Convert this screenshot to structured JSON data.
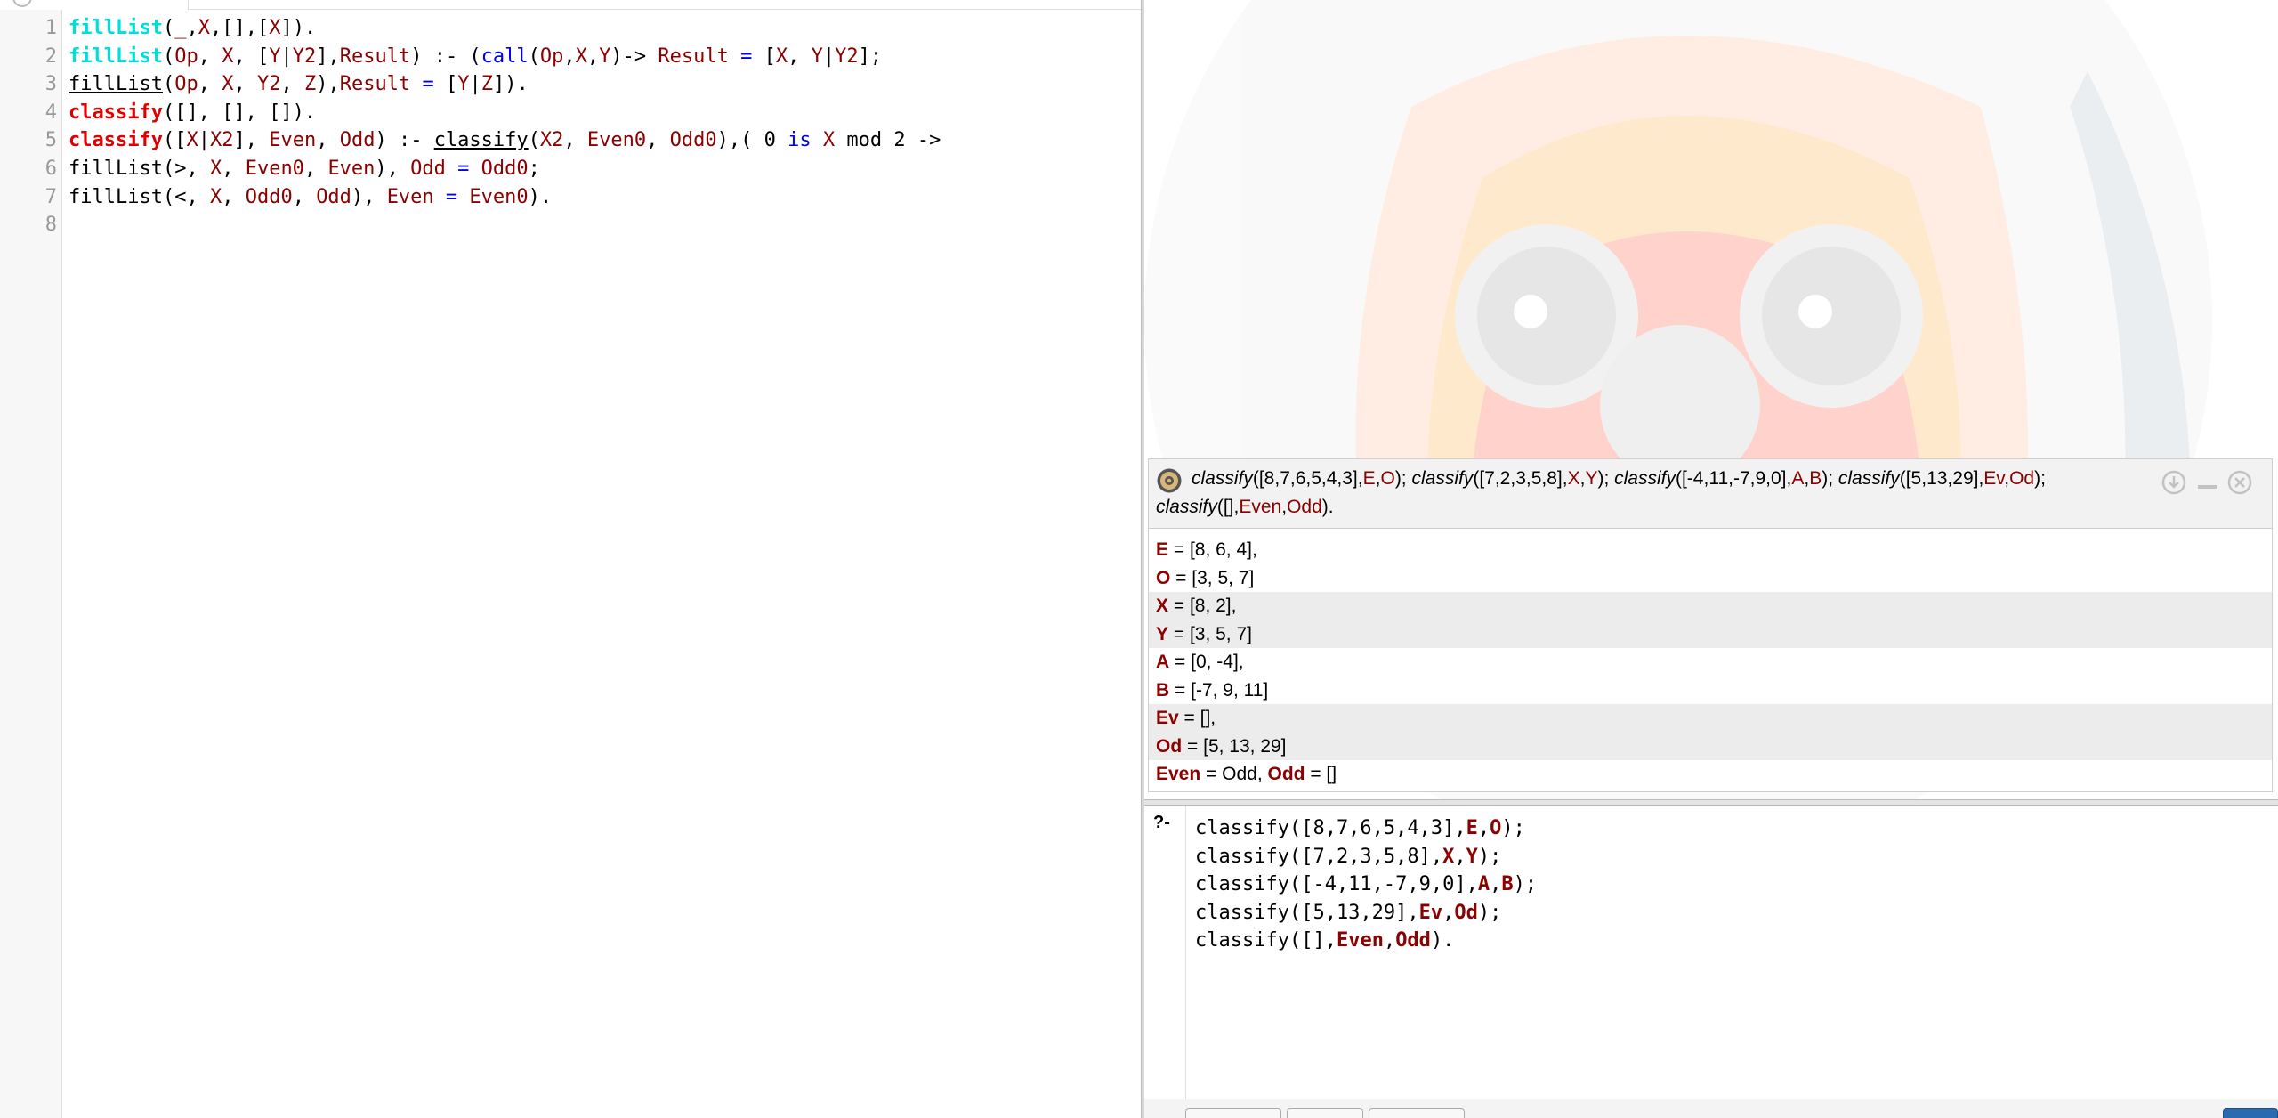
{
  "editor": {
    "line_numbers": [
      "1",
      "2",
      "3",
      "4",
      "5",
      "6",
      "7",
      "8"
    ],
    "lines": [
      [
        [
          "def",
          "fillList"
        ],
        [
          "plain",
          "("
        ],
        [
          "var",
          "_"
        ],
        [
          "plain",
          ","
        ],
        [
          "var",
          "X"
        ],
        [
          "plain",
          ",[],["
        ],
        [
          "var",
          "X"
        ],
        [
          "plain",
          "])."
        ]
      ],
      [
        [
          "def",
          "fillList"
        ],
        [
          "plain",
          "("
        ],
        [
          "var",
          "Op"
        ],
        [
          "plain",
          ", "
        ],
        [
          "var",
          "X"
        ],
        [
          "plain",
          ", ["
        ],
        [
          "var",
          "Y"
        ],
        [
          "plain",
          "|"
        ],
        [
          "var",
          "Y2"
        ],
        [
          "plain",
          "],"
        ],
        [
          "var",
          "Result"
        ],
        [
          "plain",
          ") :- ("
        ],
        [
          "kw",
          "call"
        ],
        [
          "plain",
          "("
        ],
        [
          "var",
          "Op"
        ],
        [
          "plain",
          ","
        ],
        [
          "var",
          "X"
        ],
        [
          "plain",
          ","
        ],
        [
          "var",
          "Y"
        ],
        [
          "plain",
          ")-> "
        ],
        [
          "var",
          "Result"
        ],
        [
          "plain",
          " "
        ],
        [
          "kw",
          "="
        ],
        [
          "plain",
          " ["
        ],
        [
          "var",
          "X"
        ],
        [
          "plain",
          ", "
        ],
        [
          "var",
          "Y"
        ],
        [
          "plain",
          "|"
        ],
        [
          "var",
          "Y2"
        ],
        [
          "plain",
          "];"
        ]
      ],
      [
        [
          "call",
          "fillList"
        ],
        [
          "plain",
          "("
        ],
        [
          "var",
          "Op"
        ],
        [
          "plain",
          ", "
        ],
        [
          "var",
          "X"
        ],
        [
          "plain",
          ", "
        ],
        [
          "var",
          "Y2"
        ],
        [
          "plain",
          ", "
        ],
        [
          "var",
          "Z"
        ],
        [
          "plain",
          "),"
        ],
        [
          "var",
          "Result"
        ],
        [
          "plain",
          " "
        ],
        [
          "kw",
          "="
        ],
        [
          "plain",
          " ["
        ],
        [
          "var",
          "Y"
        ],
        [
          "plain",
          "|"
        ],
        [
          "var",
          "Z"
        ],
        [
          "plain",
          "])."
        ]
      ],
      [
        [
          "cls",
          "classify"
        ],
        [
          "plain",
          "([], [], [])."
        ]
      ],
      [
        [
          "cls",
          "classify"
        ],
        [
          "plain",
          "(["
        ],
        [
          "var",
          "X"
        ],
        [
          "plain",
          "|"
        ],
        [
          "var",
          "X2"
        ],
        [
          "plain",
          "], "
        ],
        [
          "var",
          "Even"
        ],
        [
          "plain",
          ", "
        ],
        [
          "var",
          "Odd"
        ],
        [
          "plain",
          ") :- "
        ],
        [
          "call",
          "classify"
        ],
        [
          "plain",
          "("
        ],
        [
          "var",
          "X2"
        ],
        [
          "plain",
          ", "
        ],
        [
          "var",
          "Even0"
        ],
        [
          "plain",
          ", "
        ],
        [
          "var",
          "Odd0"
        ],
        [
          "plain",
          "),( 0 "
        ],
        [
          "kw",
          "is"
        ],
        [
          "plain",
          " "
        ],
        [
          "var",
          "X"
        ],
        [
          "plain",
          " mod 2 ->"
        ]
      ],
      [
        [
          "plain",
          "fillList(>, "
        ],
        [
          "var",
          "X"
        ],
        [
          "plain",
          ", "
        ],
        [
          "var",
          "Even0"
        ],
        [
          "plain",
          ", "
        ],
        [
          "var",
          "Even"
        ],
        [
          "plain",
          "), "
        ],
        [
          "var",
          "Odd"
        ],
        [
          "plain",
          " "
        ],
        [
          "kw",
          "="
        ],
        [
          "plain",
          " "
        ],
        [
          "var",
          "Odd0"
        ],
        [
          "plain",
          ";"
        ]
      ],
      [
        [
          "plain",
          "fillList(<, "
        ],
        [
          "var",
          "X"
        ],
        [
          "plain",
          ", "
        ],
        [
          "var",
          "Odd0"
        ],
        [
          "plain",
          ", "
        ],
        [
          "var",
          "Odd"
        ],
        [
          "plain",
          "), "
        ],
        [
          "var",
          "Even"
        ],
        [
          "plain",
          " "
        ],
        [
          "kw",
          "="
        ],
        [
          "plain",
          " "
        ],
        [
          "var",
          "Even0"
        ],
        [
          "plain",
          ")."
        ]
      ],
      []
    ]
  },
  "answer": {
    "query_line1": [
      [
        "i",
        "classify"
      ],
      [
        "p",
        "([8,7,6,5,4,3],"
      ],
      [
        "v",
        "E"
      ],
      [
        "p",
        ","
      ],
      [
        "v",
        "O"
      ],
      [
        "p",
        "); "
      ],
      [
        "i",
        "classify"
      ],
      [
        "p",
        "([7,2,3,5,8],"
      ],
      [
        "v",
        "X"
      ],
      [
        "p",
        ","
      ],
      [
        "v",
        "Y"
      ],
      [
        "p",
        "); "
      ],
      [
        "i",
        "classify"
      ],
      [
        "p",
        "([-4,11,-7,9,0],"
      ],
      [
        "v",
        "A"
      ],
      [
        "p",
        ","
      ],
      [
        "v",
        "B"
      ],
      [
        "p",
        "); "
      ],
      [
        "i",
        "classify"
      ],
      [
        "p",
        "([5,13,29],"
      ],
      [
        "v",
        "Ev"
      ],
      [
        "p",
        ","
      ],
      [
        "v",
        "Od"
      ],
      [
        "p",
        ");"
      ]
    ],
    "query_line2": [
      [
        "i",
        "classify"
      ],
      [
        "p",
        "([],"
      ],
      [
        "v",
        "Even"
      ],
      [
        "p",
        ","
      ],
      [
        "v",
        "Odd"
      ],
      [
        "p",
        ")."
      ]
    ],
    "rows": [
      {
        "var": "E",
        "val": " = [8, 6, 4],",
        "alt": false
      },
      {
        "var": "O",
        "val": " = [3, 5, 7]",
        "alt": false
      },
      {
        "var": "X",
        "val": " = [8, 2],",
        "alt": true
      },
      {
        "var": "Y",
        "val": " = [3, 5, 7]",
        "alt": true
      },
      {
        "var": "A",
        "val": " = [0, -4],",
        "alt": false
      },
      {
        "var": "B",
        "val": " = [-7, 9, 11]",
        "alt": false
      },
      {
        "var": "Ev",
        "val": " = [],",
        "alt": true
      },
      {
        "var": "Od",
        "val": " = [5, 13, 29]",
        "alt": true
      }
    ],
    "last_row": {
      "var1": "Even",
      "mid": " = Odd, ",
      "var2": "Odd",
      "end": " = []"
    }
  },
  "query": {
    "prompt": "?-",
    "lines": [
      [
        [
          "p",
          "classify([8,7,6,5,4,3],"
        ],
        [
          "v",
          "E"
        ],
        [
          "p",
          ","
        ],
        [
          "v",
          "O"
        ],
        [
          "p",
          ");"
        ]
      ],
      [
        [
          "p",
          "classify([7,2,3,5,8],"
        ],
        [
          "v",
          "X"
        ],
        [
          "p",
          ","
        ],
        [
          "v",
          "Y"
        ],
        [
          "p",
          ");"
        ]
      ],
      [
        [
          "p",
          "classify([-4,11,-7,9,0],"
        ],
        [
          "v",
          "A"
        ],
        [
          "p",
          ","
        ],
        [
          "v",
          "B"
        ],
        [
          "p",
          ");"
        ]
      ],
      [
        [
          "p",
          "classify([5,13,29],"
        ],
        [
          "v",
          "Ev"
        ],
        [
          "p",
          ","
        ],
        [
          "v",
          "Od"
        ],
        [
          "p",
          ");"
        ]
      ],
      [
        [
          "p",
          "classify([],"
        ],
        [
          "v",
          "Even"
        ],
        [
          "p",
          ","
        ],
        [
          "v",
          "Odd"
        ],
        [
          "p",
          ")."
        ]
      ]
    ]
  },
  "icons": {
    "answer_gear": "gear-icon",
    "download": "download-icon",
    "minimize": "minimize-icon",
    "close": "close-icon"
  },
  "colors": {
    "variable": "#8b0000",
    "definition": "#00dddd",
    "classify_head": "#e00000",
    "keyword": "#0000ee"
  }
}
